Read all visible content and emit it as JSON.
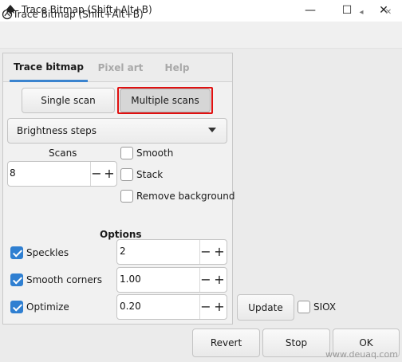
{
  "window": {
    "title": "Trace Bitmap (Shift+Alt+B)",
    "minimize_glyph": "—",
    "maximize_glyph": "☐",
    "close_glyph": "✕"
  },
  "dock": {
    "title": "Trace Bitmap (Shift+Alt+B)",
    "pin_glyph": "◂",
    "close_glyph": "✕"
  },
  "tabs": [
    {
      "label": "Trace bitmap",
      "active": true
    },
    {
      "label": "Pixel art",
      "active": false
    },
    {
      "label": "Help",
      "active": false
    }
  ],
  "mode": {
    "single_label": "Single scan",
    "multiple_label": "Multiple scans",
    "selected": "Multiple scans"
  },
  "dropdown": {
    "value": "Brightness steps"
  },
  "scans": {
    "label": "Scans",
    "value": "8"
  },
  "checks": {
    "smooth": {
      "label": "Smooth",
      "checked": false
    },
    "stack": {
      "label": "Stack",
      "checked": false
    },
    "remove_bg": {
      "label": "Remove background",
      "checked": false
    }
  },
  "options": {
    "heading": "Options",
    "rows": [
      {
        "label": "Speckles",
        "checked": true,
        "value": "2"
      },
      {
        "label": "Smooth corners",
        "checked": true,
        "value": "1.00"
      },
      {
        "label": "Optimize",
        "checked": true,
        "value": "0.20"
      }
    ]
  },
  "update": {
    "label": "Update"
  },
  "siox": {
    "label": "SIOX",
    "checked": false
  },
  "footer": {
    "revert": "Revert",
    "stop": "Stop",
    "ok": "OK"
  },
  "spin_glyphs": {
    "minus": "−",
    "plus": "+"
  },
  "watermark": "www.deuaq.com"
}
